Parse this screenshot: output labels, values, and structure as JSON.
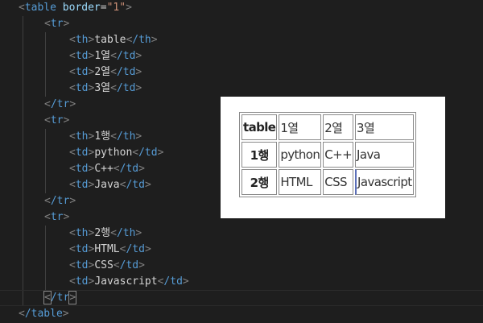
{
  "code": {
    "table_open": {
      "tag": "table",
      "attr": "border",
      "value": "\"1\""
    },
    "table_close_tag": "/table",
    "tr_tag": "tr",
    "tr_close_tag": "/tr",
    "th_tag": "th",
    "th_close_tag": "/th",
    "td_tag": "td",
    "td_close_tag": "/td",
    "rows": [
      {
        "header": "table",
        "cells": [
          "1열",
          "2열",
          "3열"
        ]
      },
      {
        "header": "1행",
        "cells": [
          "python",
          "C++",
          "Java"
        ]
      },
      {
        "header": "2행",
        "cells": [
          "HTML",
          "CSS",
          "Javascript"
        ]
      }
    ]
  },
  "preview": {
    "header_row": [
      "table",
      "1열",
      "2열",
      "3열"
    ],
    "rows": [
      {
        "header": "1행",
        "cells": [
          "python",
          "C++",
          "Java"
        ]
      },
      {
        "header": "2행",
        "cells": [
          "HTML",
          "CSS",
          "Javascript"
        ]
      }
    ]
  }
}
